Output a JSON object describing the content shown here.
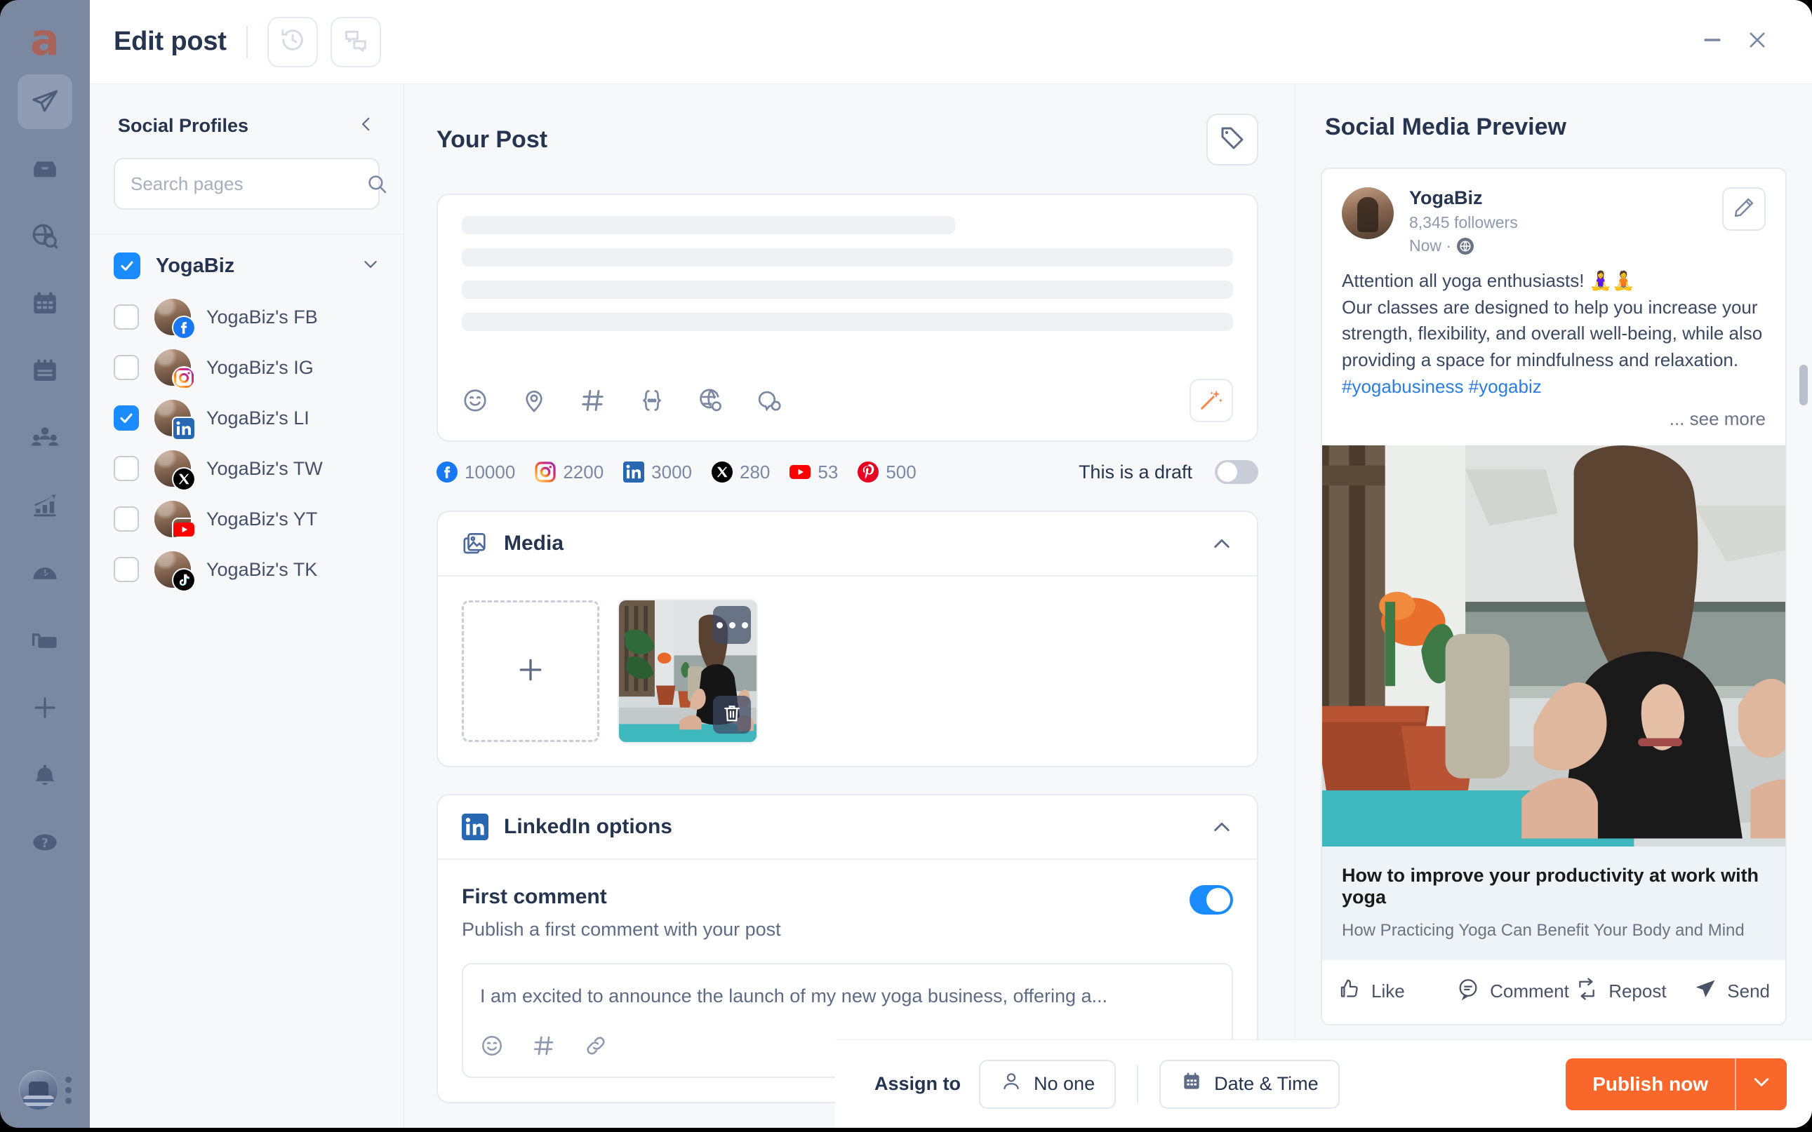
{
  "app": {
    "logo_letter": "a",
    "rail_items": [
      {
        "name": "publish-icon",
        "label": "Publish",
        "active": true
      },
      {
        "name": "inbox-icon",
        "label": "Inbox",
        "active": false
      },
      {
        "name": "discovery-icon",
        "label": "Discovery",
        "active": false
      },
      {
        "name": "calendar-grid-icon",
        "label": "Calendar",
        "active": false
      },
      {
        "name": "content-plan-icon",
        "label": "Content plan",
        "active": false
      },
      {
        "name": "audience-icon",
        "label": "Audience",
        "active": false
      },
      {
        "name": "analytics-icon",
        "label": "Analytics",
        "active": false
      },
      {
        "name": "gauge-icon",
        "label": "Monitoring",
        "active": false
      },
      {
        "name": "media-library-icon",
        "label": "Media library",
        "active": false
      },
      {
        "name": "plus-icon",
        "label": "Create",
        "active": false
      },
      {
        "name": "bell-icon",
        "label": "Notifications",
        "active": false
      },
      {
        "name": "help-icon",
        "label": "Help",
        "active": false
      }
    ]
  },
  "titlebar": {
    "title": "Edit post",
    "history_button": "history-icon",
    "comments_button": "comments-icon",
    "minimize_button": "minimize-icon",
    "close_button": "close-icon"
  },
  "sidebar": {
    "title": "Social Profiles",
    "collapse_icon": "chevron-left-icon",
    "search": {
      "placeholder": "Search pages",
      "value": "",
      "icon": "search-icon"
    },
    "group": {
      "name": "YogaBiz",
      "checked": true,
      "expand_icon": "chevron-down-icon"
    },
    "profiles": [
      {
        "label": "YogaBiz's FB",
        "network": "facebook",
        "checked": false
      },
      {
        "label": "YogaBiz's IG",
        "network": "instagram",
        "checked": false
      },
      {
        "label": "YogaBiz's LI",
        "network": "linkedin",
        "checked": true
      },
      {
        "label": "YogaBiz's TW",
        "network": "x",
        "checked": false
      },
      {
        "label": "YogaBiz's YT",
        "network": "youtube",
        "checked": false
      },
      {
        "label": "YogaBiz's TK",
        "network": "tiktok",
        "checked": false
      }
    ]
  },
  "post": {
    "title": "Your Post",
    "tag_button_icon": "tag-icon",
    "editor_value": "",
    "editor_tools": [
      {
        "name": "emoji-icon"
      },
      {
        "name": "location-pin-icon"
      },
      {
        "name": "hashtag-icon"
      },
      {
        "name": "variable-icon"
      },
      {
        "name": "globe-translate-icon"
      },
      {
        "name": "comment-bubble-icon"
      }
    ],
    "ai_button_icon": "magic-wand-icon",
    "counts": [
      {
        "network": "facebook",
        "value": "10000"
      },
      {
        "network": "instagram",
        "value": "2200"
      },
      {
        "network": "linkedin",
        "value": "3000"
      },
      {
        "network": "x",
        "value": "280"
      },
      {
        "network": "youtube",
        "value": "53"
      },
      {
        "network": "pinterest",
        "value": "500"
      }
    ],
    "draft_label": "This is a draft",
    "draft_on": false,
    "media": {
      "title": "Media",
      "icon": "media-image-icon",
      "collapse_icon": "chevron-up-icon",
      "add_label": "+",
      "thumb_menu_icon": "more-dots-icon",
      "thumb_delete_icon": "trash-icon"
    },
    "linkedin_options": {
      "title": "LinkedIn options",
      "icon": "linkedin-icon",
      "collapse_icon": "chevron-up-icon",
      "first_comment": {
        "title": "First comment",
        "subtitle": "Publish a first comment with your post",
        "enabled": true,
        "value": "I am excited to announce the launch of my new yoga business, offering a...",
        "tools": [
          {
            "name": "emoji-icon"
          },
          {
            "name": "hashtag-icon"
          },
          {
            "name": "link-icon"
          }
        ]
      }
    }
  },
  "preview": {
    "title": "Social Media Preview",
    "edit_icon": "pencil-icon",
    "account_name": "YogaBiz",
    "followers": "8,345 followers",
    "time": "Now ·",
    "visibility_icon": "globe-icon",
    "body_line1": "Attention all yoga enthusiasts! 🧘‍♀️🧘",
    "body_line2": "Our classes are designed to help you increase your strength, flexibility, and overall well-being, while also providing a space for mindfulness and relaxation. ",
    "hashtags": "#yogabusiness #yogabiz",
    "see_more": "... see more",
    "link_title": "How to improve your productivity at work with yoga",
    "link_subtitle": "How Practicing Yoga Can Benefit Your Body and Mind",
    "actions": [
      {
        "label": "Like",
        "icon": "thumbs-up-icon"
      },
      {
        "label": "Comment",
        "icon": "comment-icon"
      },
      {
        "label": "Repost",
        "icon": "repost-icon"
      },
      {
        "label": "Send",
        "icon": "send-icon"
      }
    ]
  },
  "actionbar": {
    "assign_label": "Assign to",
    "assignee": "No one",
    "assignee_icon": "user-icon",
    "date_time_label": "Date & Time",
    "date_time_icon": "calendar-icon",
    "publish_label": "Publish now",
    "publish_caret_icon": "chevron-down-icon"
  },
  "colors": {
    "rail": "#7b88a1",
    "accent_blue": "#1a8cff",
    "publish_orange": "#f9682a",
    "text_dark": "#26354f",
    "text_muted": "#7b88a1",
    "panel_bg": "#f7f8fa"
  }
}
